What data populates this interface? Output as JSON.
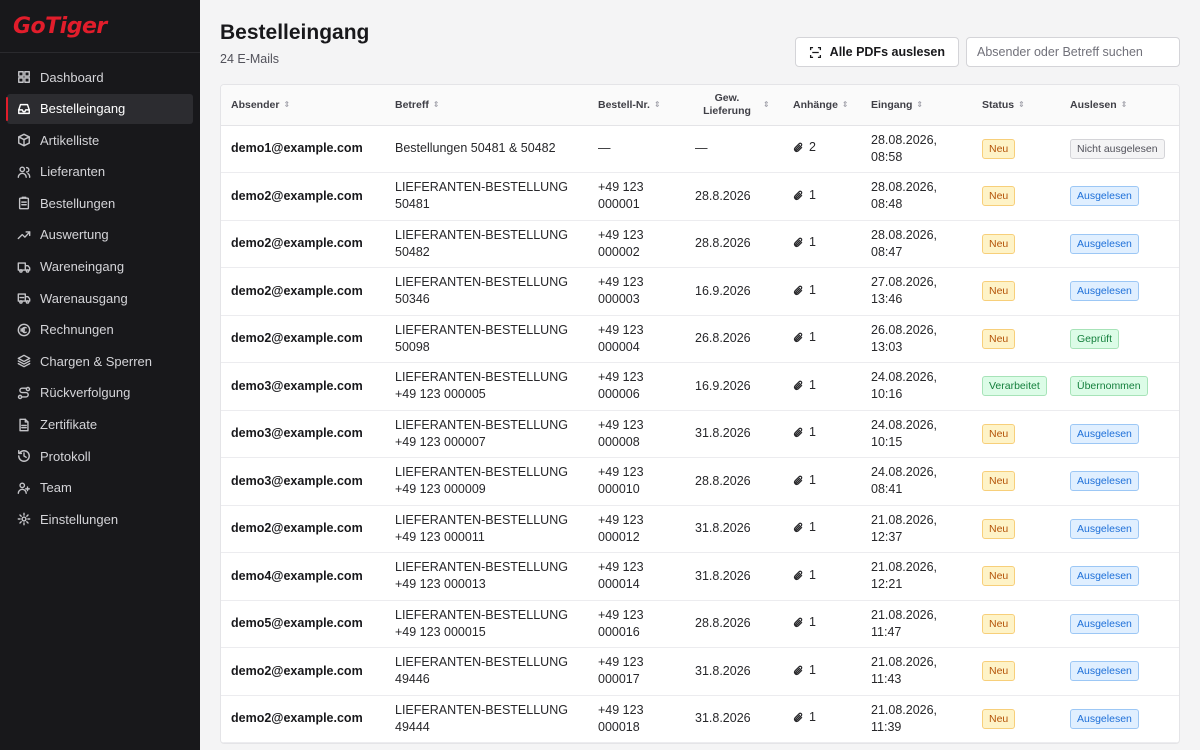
{
  "app": {
    "logo": "GoTiger"
  },
  "sidebar": {
    "items": [
      {
        "label": "Dashboard",
        "icon": "grid-icon",
        "active": false
      },
      {
        "label": "Bestelleingang",
        "icon": "inbox-icon",
        "active": true
      },
      {
        "label": "Artikelliste",
        "icon": "box-icon",
        "active": false
      },
      {
        "label": "Lieferanten",
        "icon": "users-icon",
        "active": false
      },
      {
        "label": "Bestellungen",
        "icon": "clipboard-icon",
        "active": false
      },
      {
        "label": "Auswertung",
        "icon": "trend-icon",
        "active": false
      },
      {
        "label": "Wareneingang",
        "icon": "truck-icon",
        "active": false
      },
      {
        "label": "Warenausgang",
        "icon": "truck-out-icon",
        "active": false
      },
      {
        "label": "Rechnungen",
        "icon": "euro-icon",
        "active": false
      },
      {
        "label": "Chargen & Sperren",
        "icon": "layers-icon",
        "active": false
      },
      {
        "label": "Rückverfolgung",
        "icon": "route-icon",
        "active": false
      },
      {
        "label": "Zertifikate",
        "icon": "file-icon",
        "active": false
      },
      {
        "label": "Protokoll",
        "icon": "history-icon",
        "active": false
      },
      {
        "label": "Team",
        "icon": "team-icon",
        "active": false
      },
      {
        "label": "Einstellungen",
        "icon": "gear-icon",
        "active": false
      }
    ]
  },
  "header": {
    "title": "Bestelleingang",
    "subtitle": "24 E-Mails",
    "read_all_label": "Alle PDFs auslesen",
    "search_placeholder": "Absender oder Betreff suchen"
  },
  "table": {
    "columns": [
      "Absender",
      "Betreff",
      "Bestell-Nr.",
      "Gew. Lieferung",
      "Anhänge",
      "Eingang",
      "Status",
      "Auslesen"
    ],
    "rows": [
      {
        "sender": "demo1@example.com",
        "subject": "Bestellungen 50481 & 50482",
        "order_no": "—",
        "delivery": "—",
        "attachments": "2",
        "received": "28.08.2026, 08:58",
        "status": "Neu",
        "read": "Nicht ausgelesen"
      },
      {
        "sender": "demo2@example.com",
        "subject": "LIEFERANTEN-BESTELLUNG 50481",
        "order_no": "+49 123 000001",
        "delivery": "28.8.2026",
        "attachments": "1",
        "received": "28.08.2026, 08:48",
        "status": "Neu",
        "read": "Ausgelesen"
      },
      {
        "sender": "demo2@example.com",
        "subject": "LIEFERANTEN-BESTELLUNG 50482",
        "order_no": "+49 123 000002",
        "delivery": "28.8.2026",
        "attachments": "1",
        "received": "28.08.2026, 08:47",
        "status": "Neu",
        "read": "Ausgelesen"
      },
      {
        "sender": "demo2@example.com",
        "subject": "LIEFERANTEN-BESTELLUNG 50346",
        "order_no": "+49 123 000003",
        "delivery": "16.9.2026",
        "attachments": "1",
        "received": "27.08.2026, 13:46",
        "status": "Neu",
        "read": "Ausgelesen"
      },
      {
        "sender": "demo2@example.com",
        "subject": "LIEFERANTEN-BESTELLUNG 50098",
        "order_no": "+49 123 000004",
        "delivery": "26.8.2026",
        "attachments": "1",
        "received": "26.08.2026, 13:03",
        "status": "Neu",
        "read": "Geprüft"
      },
      {
        "sender": "demo3@example.com",
        "subject": "LIEFERANTEN-BESTELLUNG +49 123 000005",
        "order_no": "+49 123 000006",
        "delivery": "16.9.2026",
        "attachments": "1",
        "received": "24.08.2026, 10:16",
        "status": "Verarbeitet",
        "read": "Übernommen"
      },
      {
        "sender": "demo3@example.com",
        "subject": "LIEFERANTEN-BESTELLUNG +49 123 000007",
        "order_no": "+49 123 000008",
        "delivery": "31.8.2026",
        "attachments": "1",
        "received": "24.08.2026, 10:15",
        "status": "Neu",
        "read": "Ausgelesen"
      },
      {
        "sender": "demo3@example.com",
        "subject": "LIEFERANTEN-BESTELLUNG +49 123 000009",
        "order_no": "+49 123 000010",
        "delivery": "28.8.2026",
        "attachments": "1",
        "received": "24.08.2026, 08:41",
        "status": "Neu",
        "read": "Ausgelesen"
      },
      {
        "sender": "demo2@example.com",
        "subject": "LIEFERANTEN-BESTELLUNG +49 123 000011",
        "order_no": "+49 123 000012",
        "delivery": "31.8.2026",
        "attachments": "1",
        "received": "21.08.2026, 12:37",
        "status": "Neu",
        "read": "Ausgelesen"
      },
      {
        "sender": "demo4@example.com",
        "subject": "LIEFERANTEN-BESTELLUNG +49 123 000013",
        "order_no": "+49 123 000014",
        "delivery": "31.8.2026",
        "attachments": "1",
        "received": "21.08.2026, 12:21",
        "status": "Neu",
        "read": "Ausgelesen"
      },
      {
        "sender": "demo5@example.com",
        "subject": "LIEFERANTEN-BESTELLUNG +49 123 000015",
        "order_no": "+49 123 000016",
        "delivery": "28.8.2026",
        "attachments": "1",
        "received": "21.08.2026, 11:47",
        "status": "Neu",
        "read": "Ausgelesen"
      },
      {
        "sender": "demo2@example.com",
        "subject": "LIEFERANTEN-BESTELLUNG 49446",
        "order_no": "+49 123 000017",
        "delivery": "31.8.2026",
        "attachments": "1",
        "received": "21.08.2026, 11:43",
        "status": "Neu",
        "read": "Ausgelesen"
      },
      {
        "sender": "demo2@example.com",
        "subject": "LIEFERANTEN-BESTELLUNG 49444",
        "order_no": "+49 123 000018",
        "delivery": "31.8.2026",
        "attachments": "1",
        "received": "21.08.2026, 11:39",
        "status": "Neu",
        "read": "Ausgelesen"
      }
    ]
  },
  "colors": {
    "brand": "#e11d2b",
    "sidebar_bg": "#18181b",
    "badge_new": "#b45309",
    "badge_done": "#15803d",
    "badge_read": "#1d6fd8"
  }
}
